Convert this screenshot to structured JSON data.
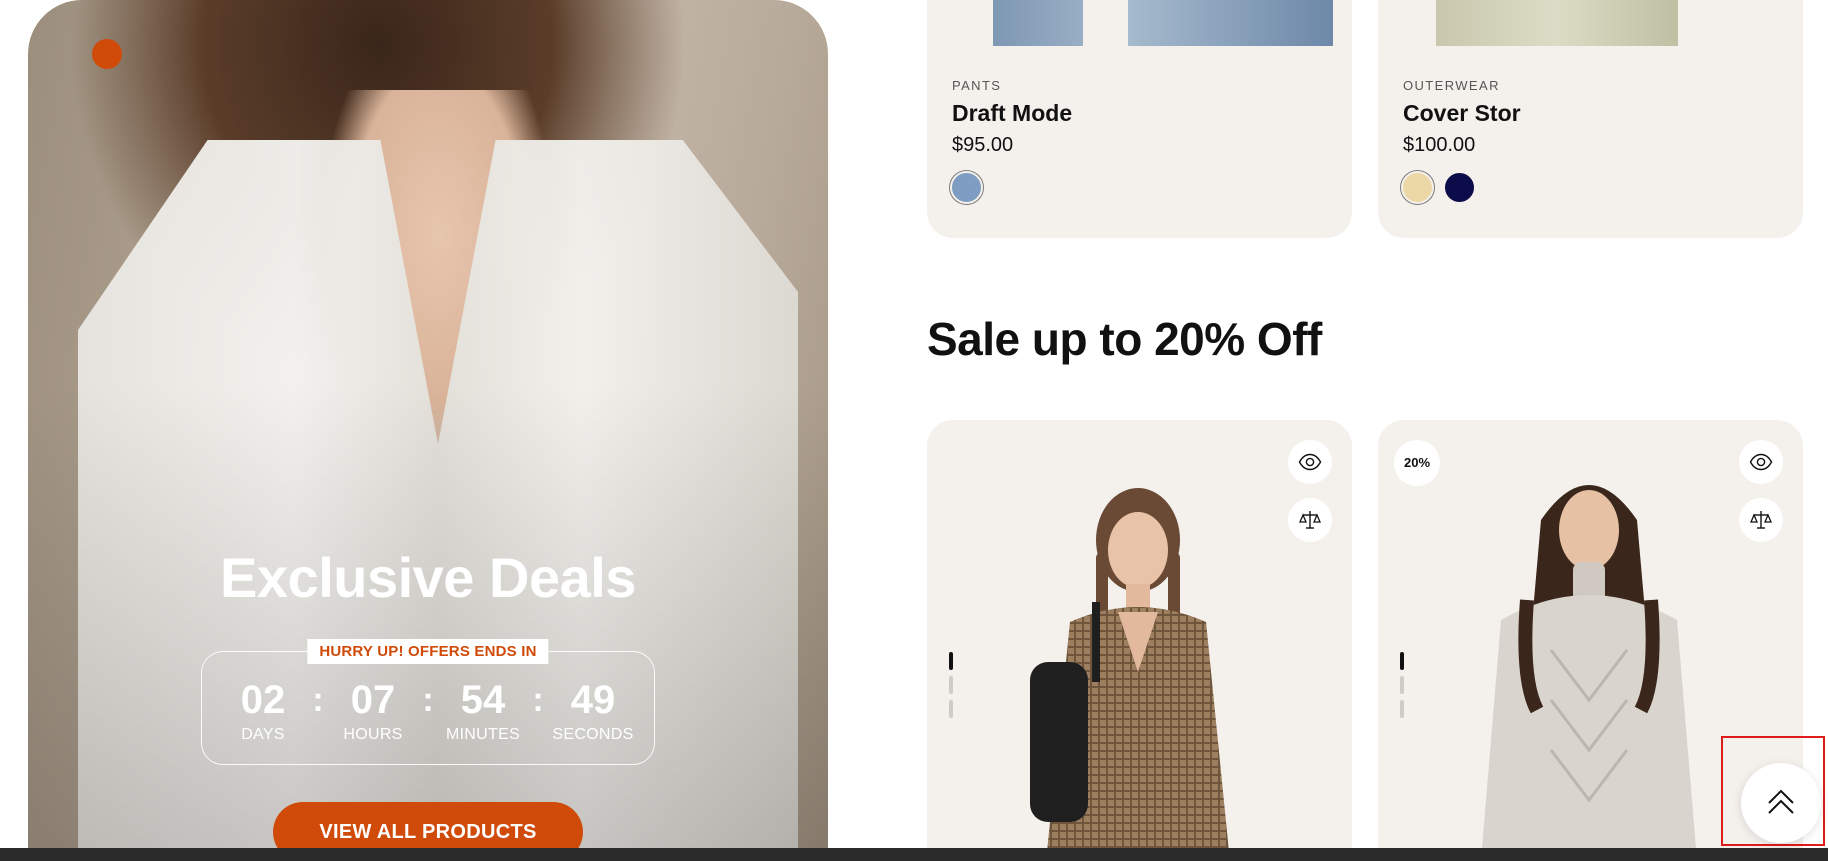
{
  "hero": {
    "title": "Exclusive Deals",
    "hurry_label": "HURRY UP! OFFERS ENDS IN",
    "countdown": [
      {
        "value": "02",
        "label": "DAYS"
      },
      {
        "value": "07",
        "label": "HOURS"
      },
      {
        "value": "54",
        "label": "MINUTES"
      },
      {
        "value": "49",
        "label": "SECONDS"
      }
    ],
    "separator": ":",
    "cta_label": "VIEW ALL PRODUCTS",
    "accent_color": "#d04a0a"
  },
  "products": [
    {
      "category": "PANTS",
      "name": "Draft Mode",
      "price": "$95.00",
      "swatches": [
        "#7f9dc2"
      ]
    },
    {
      "category": "OUTERWEAR",
      "name": "Cover Stor",
      "price": "$100.00",
      "swatches": [
        "#ecd7a6",
        "#0d0c4a"
      ]
    }
  ],
  "sale": {
    "title": "Sale up to 20% Off",
    "cards": [
      {
        "badge": "",
        "actions": [
          "eye-icon",
          "compare-icon"
        ]
      },
      {
        "badge": "20%",
        "actions": [
          "eye-icon",
          "compare-icon"
        ]
      }
    ]
  },
  "scroll_top": {
    "icon": "double-chevron-up-icon"
  }
}
